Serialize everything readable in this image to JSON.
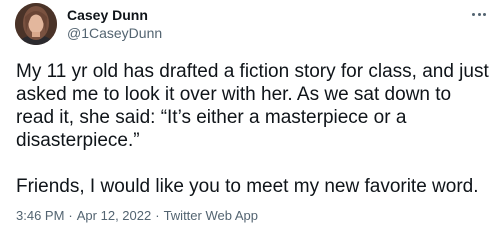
{
  "tweet": {
    "author": {
      "display_name": "Casey Dunn",
      "handle": "@1CaseyDunn"
    },
    "more_icon": "more-horizontal-icon",
    "paragraphs": [
      "My 11 yr old has drafted a fiction story for class, and just asked me to look it over with her. As we sat down to read it, she said: “It’s either a masterpiece or a disasterpiece.”",
      "Friends, I would like you to meet my new favorite word."
    ],
    "meta": {
      "time": "3:46 PM",
      "separator": "·",
      "date": "Apr 12, 2022",
      "source": "Twitter Web App"
    },
    "colors": {
      "text": "#0f1419",
      "secondary": "#536471"
    }
  }
}
